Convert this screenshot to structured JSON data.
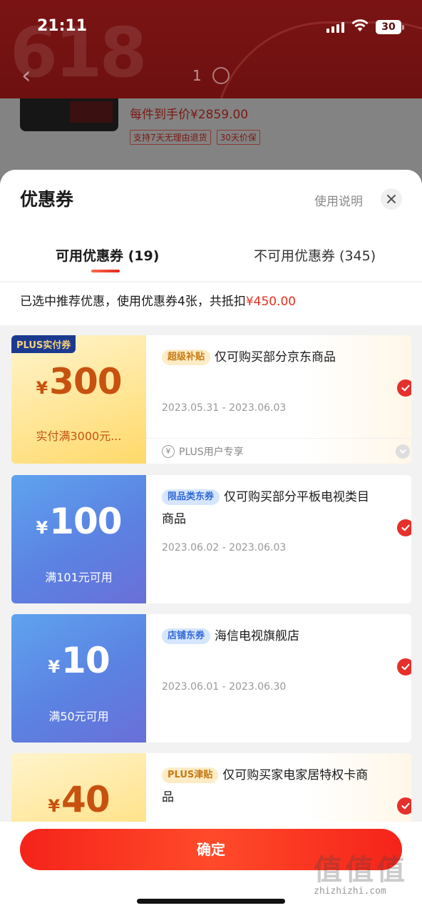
{
  "status_bar": {
    "time": "21:11",
    "battery": "30"
  },
  "background": {
    "watermark_number": "618",
    "image_counter": "1",
    "price_line": "每件到手价¥2859.00",
    "tags": [
      "支持7天无理由退货",
      "30天价保"
    ]
  },
  "sheet": {
    "title": "优惠券",
    "help_label": "使用说明",
    "tabs": [
      {
        "label": "可用优惠券 (19)",
        "active": true
      },
      {
        "label": "不可用优惠券 (345)",
        "active": false
      }
    ],
    "summary": {
      "text": "已选中推荐优惠，使用优惠券4张，共抵扣",
      "amount": "¥450.00"
    }
  },
  "coupons": [
    {
      "badge": "PLUS实付券",
      "currency": "¥",
      "amount": "300",
      "condition": "实付满3000元...",
      "tag": "超级补贴",
      "title": "仅可购买部分京东商品",
      "dates": "2023.05.31 - 2023.06.03",
      "footer": "PLUS用户专享",
      "footer_icon": "¥",
      "style": "gold",
      "selected": true
    },
    {
      "currency": "¥",
      "amount": "100",
      "condition": "满101元可用",
      "tag": "限品类东券",
      "title": "仅可购买部分平板电视类目商品",
      "dates": "2023.06.02 - 2023.06.03",
      "style": "blue",
      "selected": true
    },
    {
      "currency": "¥",
      "amount": "10",
      "condition": "满50元可用",
      "tag": "店铺东券",
      "title": "海信电视旗舰店",
      "dates": "2023.06.01 - 2023.06.30",
      "style": "blue",
      "selected": true
    },
    {
      "currency": "¥",
      "amount": "40",
      "tag": "PLUS津贴",
      "title": "仅可购买家电家居特权卡商品",
      "style": "gold",
      "selected": true
    }
  ],
  "confirm_label": "确定",
  "watermark": {
    "logo": "值值值",
    "url": "zhizhizhi.com"
  },
  "colors": {
    "accent": "#e5301d",
    "confirm": "#f5231a",
    "gold_text": "#c7520f",
    "blue_coupon": "#5b82e2"
  }
}
